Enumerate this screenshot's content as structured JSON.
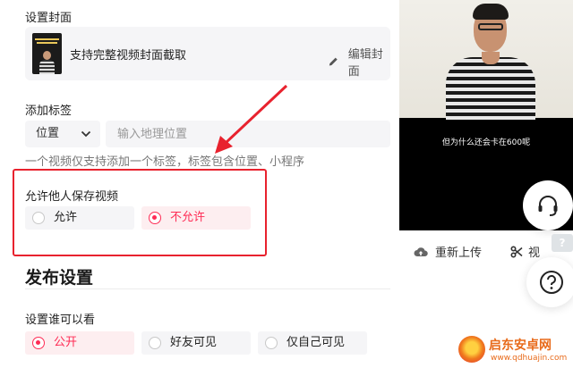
{
  "cover": {
    "section_label": "设置封面",
    "title": "支持完整视频封面截取",
    "edit_label": "编辑封面",
    "thumb_text": "完整视频封面截取"
  },
  "tags": {
    "section_label": "添加标签",
    "select_value": "位置",
    "input_placeholder": "输入地理位置",
    "hint": "一个视频仅支持添加一个标签，标签包含位置、小程序"
  },
  "save_permission": {
    "label": "允许他人保存视频",
    "options": [
      {
        "label": "允许",
        "selected": false
      },
      {
        "label": "不允许",
        "selected": true
      }
    ]
  },
  "publish": {
    "section_title": "发布设置",
    "visibility_label": "设置谁可以看",
    "options": [
      {
        "label": "公开",
        "selected": true
      },
      {
        "label": "好友可见",
        "selected": false
      },
      {
        "label": "仅自己可见",
        "selected": false
      }
    ]
  },
  "preview": {
    "subtitle": "但为什么还会卡在600呢",
    "reupload_label": "重新上传",
    "cut_label": "视"
  },
  "floating": {
    "help_tag": "?"
  },
  "watermark": {
    "name": "启东安卓网",
    "url": "www.qdhuajin.com"
  },
  "colors": {
    "accent": "#fe2c55",
    "annotation_red": "#e8222e",
    "panel_bg": "#f5f5f7"
  },
  "icons": [
    "pencil-icon",
    "chevron-down-icon",
    "upload-cloud-icon",
    "scissors-icon",
    "headset-icon",
    "question-icon"
  ]
}
